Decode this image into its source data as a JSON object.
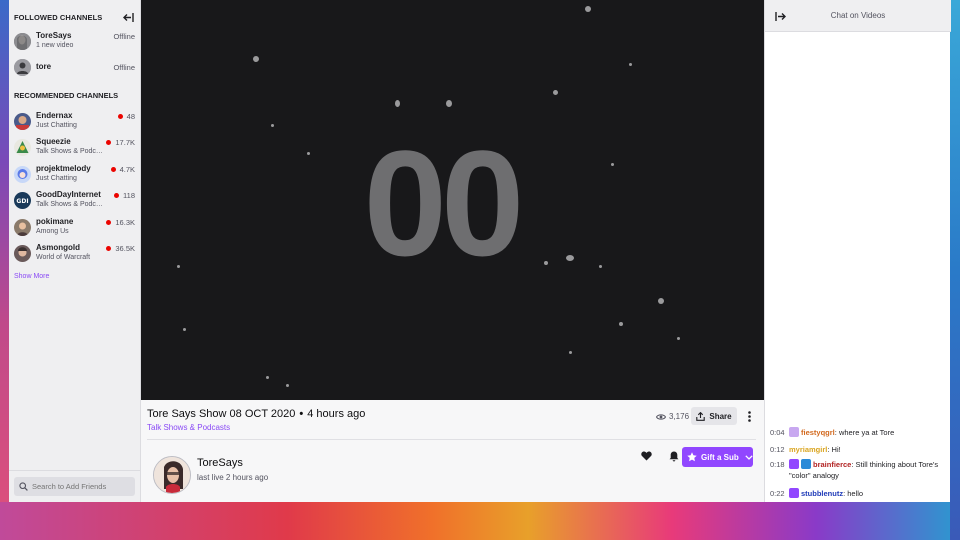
{
  "sidebar": {
    "followed_title": "FOLLOWED CHANNELS",
    "followed": [
      {
        "name": "ToreSays",
        "sub": "1 new video",
        "status": "Offline"
      },
      {
        "name": "tore",
        "sub": "",
        "status": "Offline"
      }
    ],
    "recommended_title": "RECOMMENDED CHANNELS",
    "recommended": [
      {
        "name": "Endernax",
        "sub": "Just Chatting",
        "viewers": "48"
      },
      {
        "name": "Squeezie",
        "sub": "Talk Shows & Podcasts",
        "viewers": "17.7K"
      },
      {
        "name": "projektmelody",
        "sub": "Just Chatting",
        "viewers": "4.7K"
      },
      {
        "name": "GoodDayInternet",
        "sub": "Talk Shows & Podcasts",
        "viewers": "118"
      },
      {
        "name": "pokimane",
        "sub": "Among Us",
        "viewers": "16.3K"
      },
      {
        "name": "Asmongold",
        "sub": "World of Warcraft",
        "viewers": "36.5K"
      }
    ],
    "show_more": "Show More",
    "search_placeholder": "Search to Add Friends"
  },
  "video": {
    "countdown": "00"
  },
  "info": {
    "title": "Tore Says Show 08 OCT 2020",
    "separator": "•",
    "age": "4 hours ago",
    "category": "Talk Shows & Podcasts",
    "views": "3,176",
    "share_label": "Share",
    "streamer": "ToreSays",
    "last_live": "last live 2 hours ago",
    "gift_label": "Gift a Sub"
  },
  "chat": {
    "title": "Chat on Videos",
    "messages": [
      {
        "time": "0:04",
        "user": "fiestyqgrl",
        "text": "where ya at Tore",
        "color": "#d2691e"
      },
      {
        "time": "0:12",
        "user": "myriamgirl",
        "text": "Hi!",
        "color": "#daa520"
      },
      {
        "time": "0:18",
        "user": "brainfierce",
        "text": "Still thinking about Tore's \"color\" analogy",
        "color": "#b22222"
      },
      {
        "time": "0:22",
        "user": "stubblenutz",
        "text": "hello",
        "color": "#1e3ab8"
      }
    ]
  },
  "colors": {
    "accent": "#9147ff",
    "live": "#eb0400",
    "link": "#8a4af5"
  }
}
